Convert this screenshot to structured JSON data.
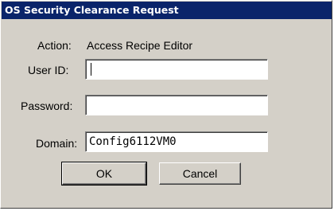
{
  "window": {
    "title": "OS Security Clearance Request"
  },
  "form": {
    "action_label": "Action:",
    "action_value": "Access Recipe Editor",
    "user_id_label": "User ID:",
    "user_id_value": "",
    "password_label": "Password:",
    "password_value": "",
    "domain_label": "Domain:",
    "domain_value": "Config6112VM0"
  },
  "buttons": {
    "ok_label": "OK",
    "cancel_label": "Cancel"
  }
}
